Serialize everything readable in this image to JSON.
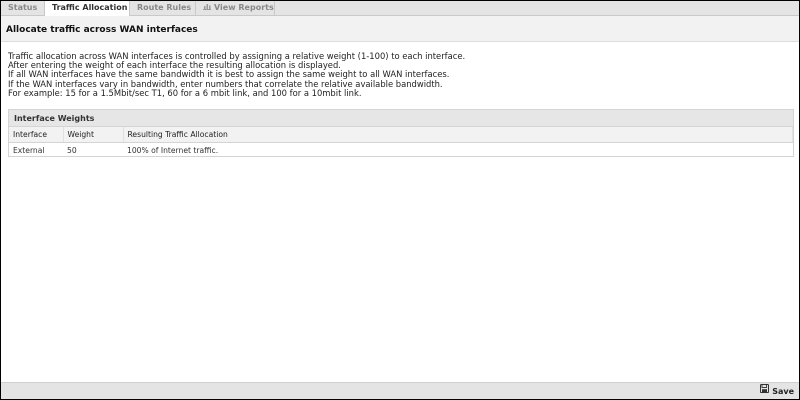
{
  "tabs": [
    {
      "label": "Status",
      "active": false
    },
    {
      "label": "Traffic Allocation",
      "active": true
    },
    {
      "label": "Route Rules",
      "active": false
    },
    {
      "label": "View Reports",
      "active": false,
      "icon": "chart-icon"
    }
  ],
  "page": {
    "title": "Allocate traffic across WAN interfaces"
  },
  "description": [
    "Traffic allocation across WAN interfaces is controlled by assigning a relative weight (1-100) to each interface.",
    "After entering the weight of each interface the resulting allocation is displayed.",
    "If all WAN interfaces have the same bandwidth it is best to assign the same weight to all WAN interfaces.",
    "If the WAN interfaces vary in bandwidth, enter numbers that correlate the relative available bandwidth.",
    "For example: 15 for a 1.5Mbit/sec T1, 60 for a 6 mbit link, and 100 for a 10mbit link."
  ],
  "weights_panel": {
    "title": "Interface Weights",
    "columns": [
      "Interface",
      "Weight",
      "Resulting Traffic Allocation"
    ],
    "rows": [
      [
        "External",
        "50",
        "100% of Internet traffic."
      ]
    ]
  },
  "footer": {
    "save_label": "Save",
    "save_icon": "floppy-disk-icon"
  }
}
